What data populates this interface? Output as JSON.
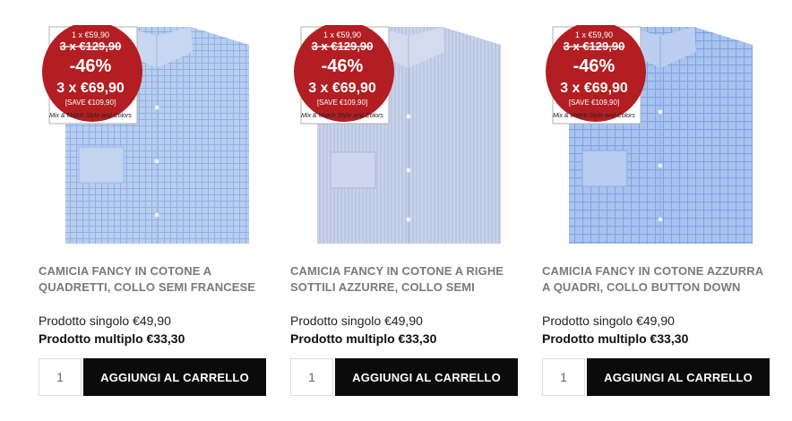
{
  "badge": {
    "single_price": "1 x €59,90",
    "old_price": "3 x €129,90",
    "discount": "-46%",
    "new_price": "3 x €69,90",
    "save": "[SAVE €109,90]",
    "tagline": "Mix & Match Style and Colors",
    "color": "#b31e22"
  },
  "products": [
    {
      "title": "CAMICIA FANCY IN COTONE A QUADRETTI, COLLO SEMI FRANCESE",
      "single_price": "Prodotto singolo €49,90",
      "multi_price": "Prodotto multiplo €33,30",
      "qty": "1",
      "button": "AGGIUNGI AL CARRELLO"
    },
    {
      "title": "CAMICIA FANCY IN COTONE A RIGHE SOTTILI AZZURRE, COLLO SEMI",
      "single_price": "Prodotto singolo €49,90",
      "multi_price": "Prodotto multiplo €33,30",
      "qty": "1",
      "button": "AGGIUNGI AL CARRELLO"
    },
    {
      "title": "CAMICIA FANCY IN COTONE AZZURRA A QUADRI, COLLO BUTTON DOWN",
      "single_price": "Prodotto singolo €49,90",
      "multi_price": "Prodotto multiplo €33,30",
      "qty": "1",
      "button": "AGGIUNGI AL CARRELLO"
    }
  ]
}
